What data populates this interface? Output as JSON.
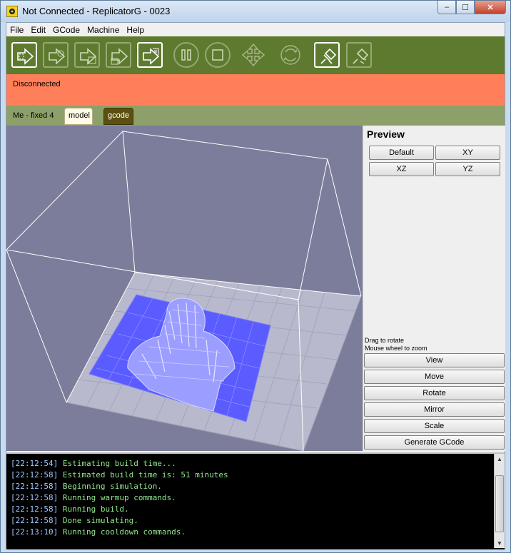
{
  "window": {
    "title": "Not Connected - ReplicatorG - 0023",
    "controls": {
      "minimize": "–",
      "maximize": "☐",
      "close": "✕"
    }
  },
  "menu": [
    "File",
    "Edit",
    "GCode",
    "Machine",
    "Help"
  ],
  "toolbar": {
    "buttons": [
      {
        "name": "build-button",
        "icon": "build-icon"
      },
      {
        "name": "simulate-button",
        "icon": "simulate-icon"
      },
      {
        "name": "build-to-file-button",
        "icon": "build-to-file-icon"
      },
      {
        "name": "upload-button",
        "icon": "upload-icon"
      },
      {
        "name": "build-from-file-button",
        "icon": "build-from-file-icon"
      },
      {
        "name": "pause-button",
        "icon": "pause-icon"
      },
      {
        "name": "stop-button",
        "icon": "stop-icon"
      },
      {
        "name": "control-panel-button",
        "icon": "move-icon"
      },
      {
        "name": "reset-button",
        "icon": "reset-icon"
      },
      {
        "name": "connect-button",
        "icon": "connect-icon"
      },
      {
        "name": "disconnect-button",
        "icon": "disconnect-icon"
      }
    ]
  },
  "status": {
    "text": "Disconnected",
    "color": "#ff7f5a"
  },
  "tabs": {
    "machine_label": "Me - fixed 4",
    "model": "model",
    "gcode": "gcode"
  },
  "preview": {
    "title": "Preview",
    "view_buttons": [
      "Default",
      "XY",
      "XZ",
      "YZ"
    ],
    "hint_rotate": "Drag to rotate",
    "hint_zoom": "Mouse wheel to zoom",
    "actions": [
      "View",
      "Move",
      "Rotate",
      "Mirror",
      "Scale",
      "Generate GCode"
    ]
  },
  "console": {
    "lines": [
      {
        "ts": "[22:12:54]",
        "msg": "Estimating build time..."
      },
      {
        "ts": "[22:12:58]",
        "msg": "Estimated build time is: 51 minutes"
      },
      {
        "ts": "[22:12:58]",
        "msg": "Beginning simulation."
      },
      {
        "ts": "[22:12:58]",
        "msg": "Running warmup commands."
      },
      {
        "ts": "[22:12:58]",
        "msg": "Running build."
      },
      {
        "ts": "[22:12:58]",
        "msg": "Done simulating."
      },
      {
        "ts": "[22:13:10]",
        "msg": "Running cooldown commands."
      }
    ]
  },
  "colors": {
    "toolbar": "#5e7a2f",
    "tabbar": "#8ea06a",
    "viewport": "#7b7d9a",
    "platform": "#5a5cff"
  }
}
